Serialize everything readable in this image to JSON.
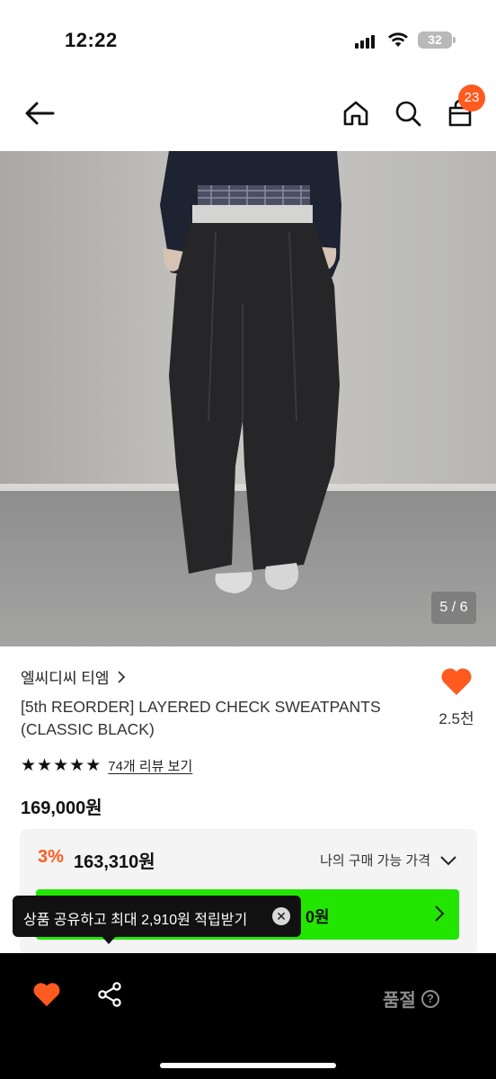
{
  "status_bar": {
    "time": "12:22",
    "battery": "32"
  },
  "nav": {
    "back_icon": "arrow-left-icon",
    "home_icon": "home-icon",
    "search_icon": "search-icon",
    "cart_icon": "shopping-bag-icon",
    "cart_count": "23"
  },
  "gallery": {
    "counter": "5 / 6"
  },
  "product": {
    "brand": "엘씨디씨 티엠",
    "title": "[5th REORDER] LAYERED CHECK SWEATPANTS (CLASSIC BLACK)",
    "like_count": "2.5천",
    "review_link": "74개 리뷰 보기",
    "price": "169,000원"
  },
  "benefit": {
    "discount": "3%",
    "sale_price": "163,310원",
    "my_price_label": "나의 구매 가능 가격",
    "button_text_visible": "0원"
  },
  "tooltip": {
    "text": "상품 공유하고 최대 2,910원 적립받기"
  },
  "bottom_bar": {
    "status": "품절",
    "help": "?"
  },
  "colors": {
    "accent": "#ff5a1f",
    "green": "#22e600",
    "bar": "#000000"
  }
}
